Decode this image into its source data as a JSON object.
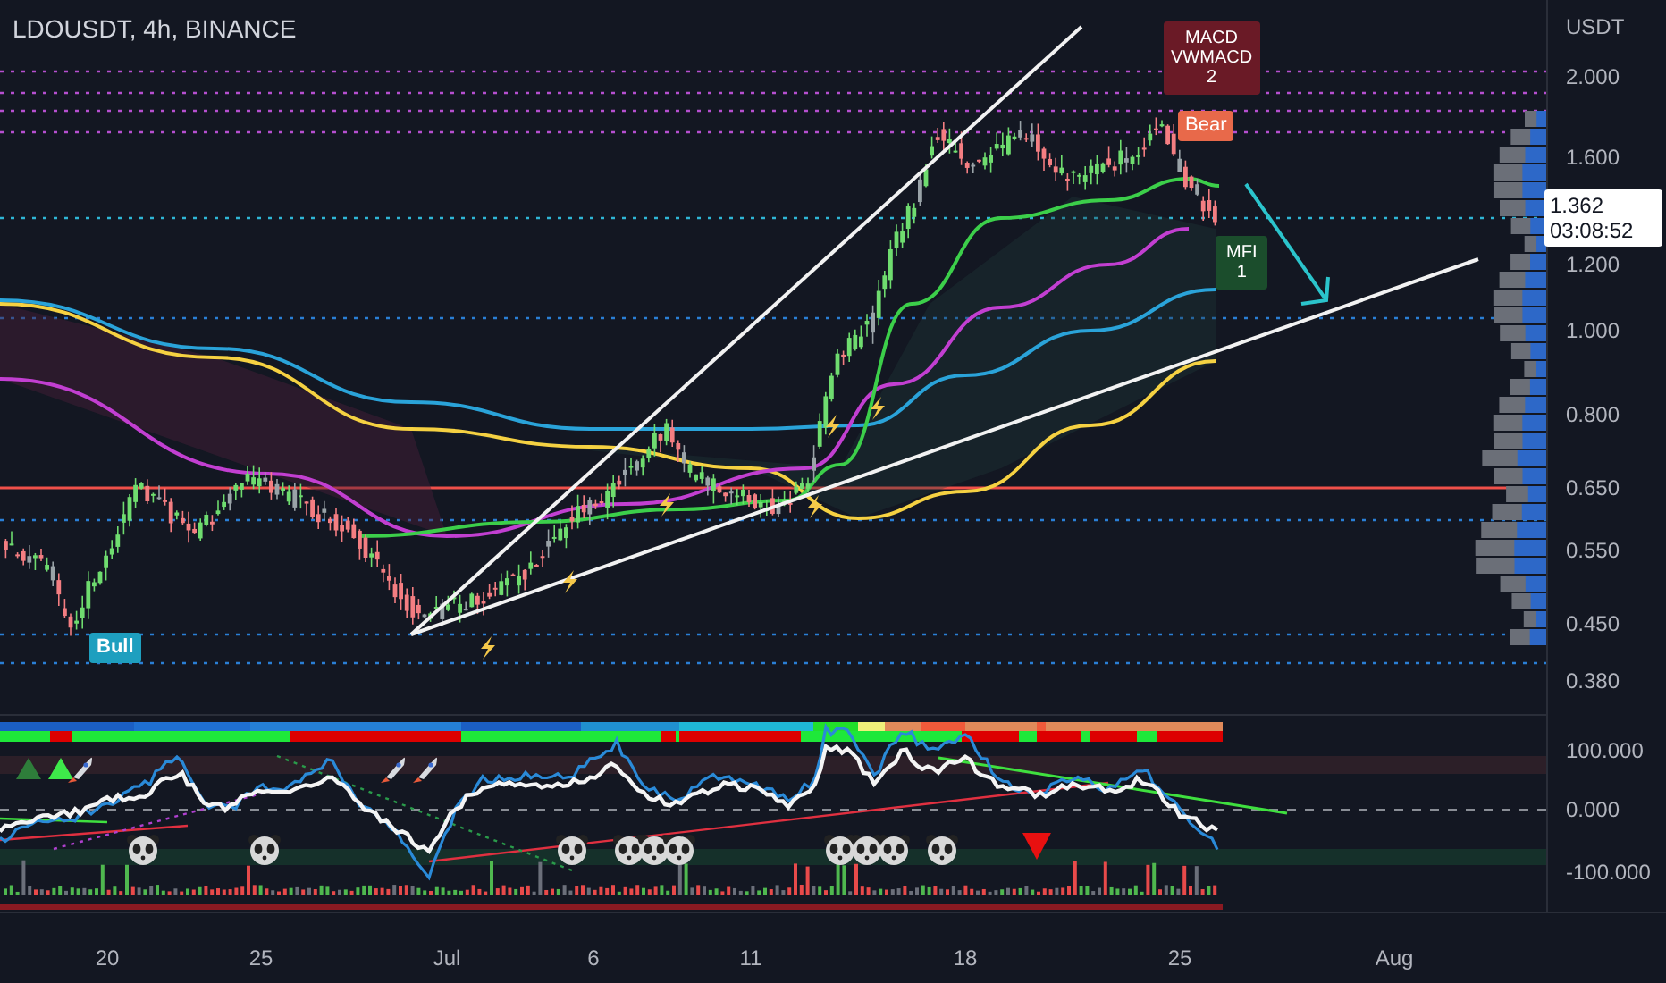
{
  "symbol": "LDOUSDT, 4h, BINANCE",
  "currency": "USDT",
  "price_axis": {
    "labels": [
      "2.000",
      "1.600",
      "1.200",
      "1.000",
      "0.800",
      "0.650",
      "0.550",
      "0.450",
      "0.380"
    ]
  },
  "last_price": {
    "price": "1.362",
    "countdown": "03:08:52"
  },
  "oscillator_axis": {
    "labels": [
      "100.000",
      "0.000",
      "-100.000"
    ]
  },
  "time_axis": {
    "labels": [
      "20",
      "25",
      "Jul",
      "6",
      "11",
      "18",
      "25",
      "Aug"
    ]
  },
  "markers": [
    {
      "kind": "sell-signal",
      "lines": [
        "MACD",
        "VWMACD",
        "2"
      ]
    },
    {
      "kind": "bear",
      "lines": [
        "Bear"
      ]
    },
    {
      "kind": "buy-signal",
      "lines": [
        "MFI",
        "1"
      ]
    },
    {
      "kind": "bull",
      "lines": [
        "Bull"
      ]
    }
  ]
}
